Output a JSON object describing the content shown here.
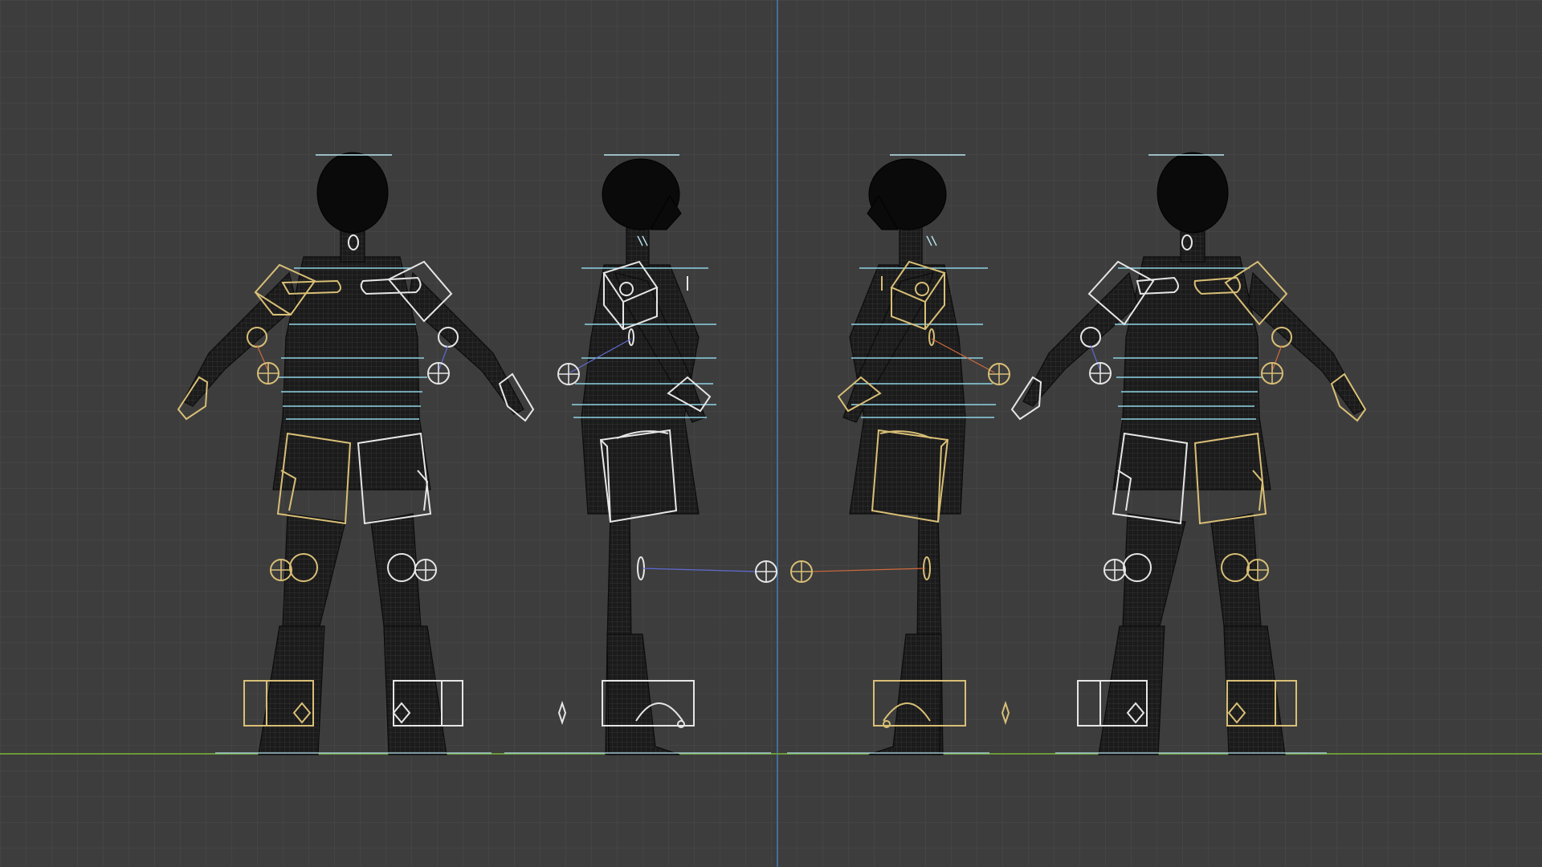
{
  "viewport": {
    "name": "3D viewport",
    "background": "#3d3d3d",
    "grid_color": "#4a4a4a",
    "axis_colors": {
      "x": "#6b9a3a",
      "z": "#3f6f9a"
    },
    "control_colors": {
      "left": "#d9bf76",
      "right": "#e6e6e6",
      "spine": "#8fd3e3",
      "pole_left": "#d06a3d",
      "pole_right": "#5f6bd0"
    },
    "icons": [
      "pole-target-icon",
      "limb-box-control",
      "spine-bar-control"
    ]
  },
  "character_views": [
    "back",
    "right-side",
    "left-side",
    "front"
  ]
}
